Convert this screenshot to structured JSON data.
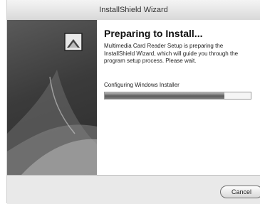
{
  "window": {
    "title": "InstallShield Wizard"
  },
  "main": {
    "heading": "Preparing to Install...",
    "description": "Multimedia Card Reader Setup is preparing the InstallShield Wizard, which will guide you through the program setup process.  Please wait.",
    "status_text": "Configuring Windows Installer",
    "progress": 0.82
  },
  "buttons": {
    "cancel_label": "Cancel"
  },
  "colors": {
    "side_panel": "#3b3b3b",
    "progress_fill": "#5d5d5d"
  },
  "icons": {
    "wizard_logo": "installshield-logo-icon"
  }
}
